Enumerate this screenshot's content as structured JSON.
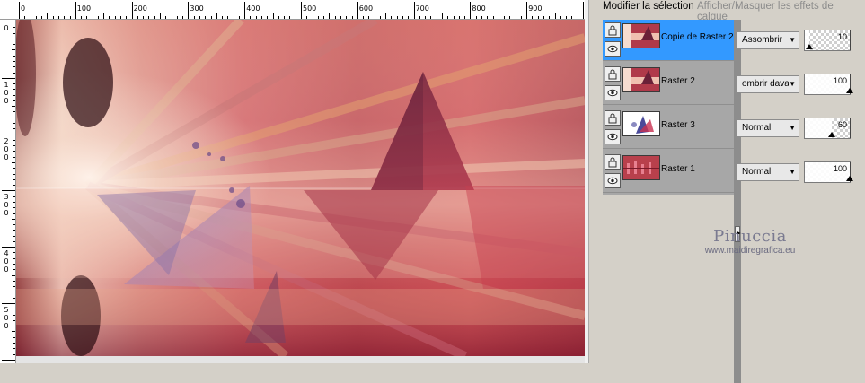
{
  "palette": {
    "modify_selection": "Modifier la sélection",
    "toggle_effects": "Afficher/Masquer les effets de calque"
  },
  "rulers": {
    "top_labels": [
      "0",
      "100",
      "200",
      "300",
      "400",
      "500",
      "600",
      "700",
      "800",
      "900"
    ],
    "left_labels": [
      [
        "0"
      ],
      [
        "1",
        "0",
        "0"
      ],
      [
        "2",
        "0",
        "0"
      ],
      [
        "3",
        "0",
        "0"
      ],
      [
        "4",
        "0",
        "0"
      ],
      [
        "5",
        "0",
        "0"
      ]
    ]
  },
  "layers": [
    {
      "name": "Copie de Raster 2",
      "blend": "Assombrir",
      "opacity": 10,
      "selected": true,
      "thumb": "abstract"
    },
    {
      "name": "Raster 2",
      "blend": "ombrir davant",
      "opacity": 100,
      "selected": false,
      "thumb": "abstract"
    },
    {
      "name": "Raster 3",
      "blend": "Normal",
      "opacity": 60,
      "selected": false,
      "thumb": "tube"
    },
    {
      "name": "Raster 1",
      "blend": "Normal",
      "opacity": 100,
      "selected": false,
      "thumb": "bars"
    }
  ],
  "watermark": {
    "name": "Pinuccia",
    "url": "www.maidiregrafica.eu"
  },
  "colors": {
    "selected_row": "#3399ff",
    "panel_bg": "#a7a7a7",
    "artwork_crimson": "#b02a3e",
    "artwork_peach": "#e9b7a0"
  }
}
